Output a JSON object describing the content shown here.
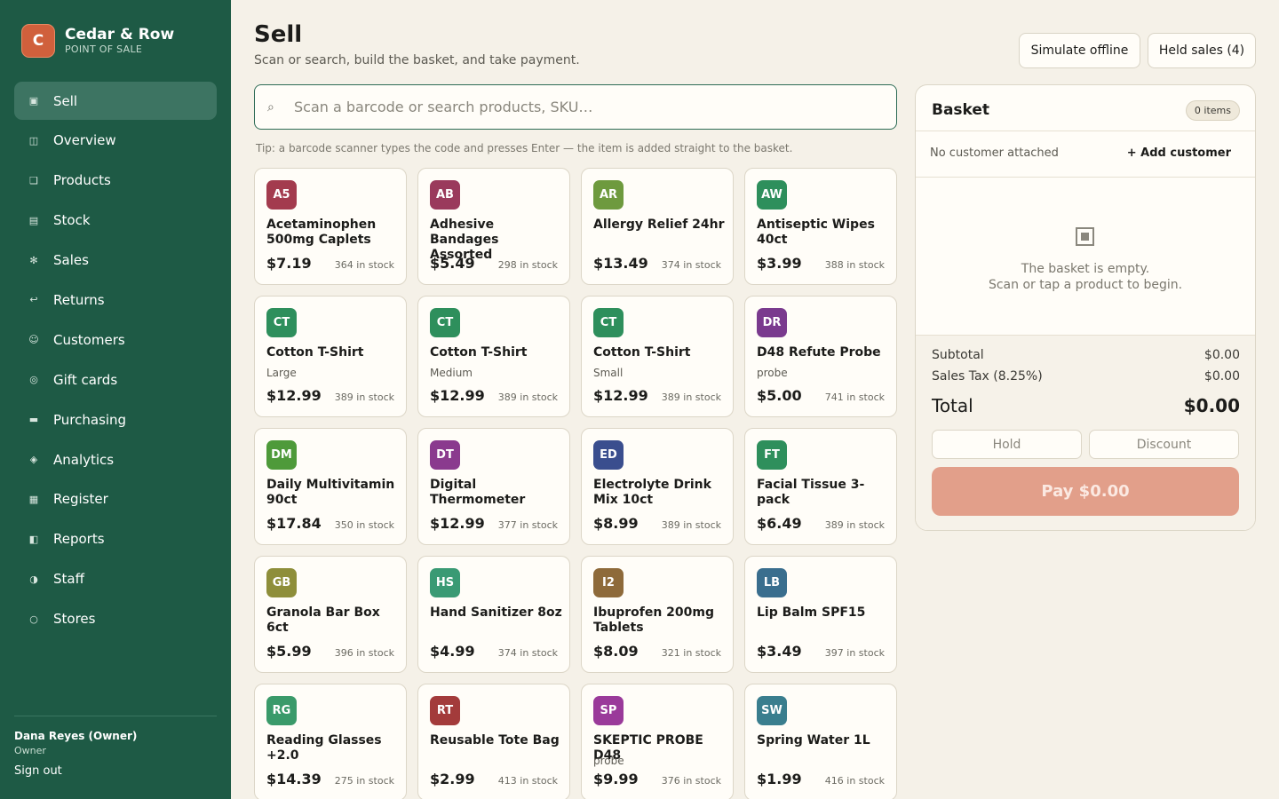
{
  "brand": {
    "logo_letter": "C",
    "name": "Cedar & Row",
    "subtitle": "POINT OF SALE"
  },
  "nav": [
    {
      "label": "Sell",
      "icon": "▣",
      "icon_name": "sell-icon",
      "active": true
    },
    {
      "label": "Overview",
      "icon": "◫",
      "icon_name": "overview-icon"
    },
    {
      "label": "Products",
      "icon": "❑",
      "icon_name": "products-icon"
    },
    {
      "label": "Stock",
      "icon": "▤",
      "icon_name": "stock-icon"
    },
    {
      "label": "Sales",
      "icon": "✻",
      "icon_name": "sales-icon"
    },
    {
      "label": "Returns",
      "icon": "↩",
      "icon_name": "returns-icon"
    },
    {
      "label": "Customers",
      "icon": "☺",
      "icon_name": "customers-icon"
    },
    {
      "label": "Gift cards",
      "icon": "◎",
      "icon_name": "gift-cards-icon"
    },
    {
      "label": "Purchasing",
      "icon": "▬",
      "icon_name": "purchasing-icon"
    },
    {
      "label": "Analytics",
      "icon": "◈",
      "icon_name": "analytics-icon"
    },
    {
      "label": "Register",
      "icon": "▦",
      "icon_name": "register-icon"
    },
    {
      "label": "Reports",
      "icon": "◧",
      "icon_name": "reports-icon"
    },
    {
      "label": "Staff",
      "icon": "◑",
      "icon_name": "staff-icon"
    },
    {
      "label": "Stores",
      "icon": "○",
      "icon_name": "stores-icon"
    }
  ],
  "user": {
    "name": "Dana Reyes (Owner)",
    "role": "Owner",
    "sign_out": "Sign out"
  },
  "header": {
    "title": "Sell",
    "subtitle": "Scan or search, build the basket, and take payment.",
    "offline_label": "Simulate offline",
    "held_label": "Held sales (4)"
  },
  "search": {
    "placeholder": "Scan a barcode or search products, SKU…",
    "icon": "⌕",
    "tip": "Tip: a barcode scanner types the code and presses Enter — the item is added straight to the basket."
  },
  "products": [
    {
      "code": "A5",
      "name": "Acetaminophen 500mg Caplets",
      "variant": "",
      "price": "$7.19",
      "stock": "364 in stock",
      "color": "#a33b4e"
    },
    {
      "code": "AB",
      "name": "Adhesive Bandages Assorted",
      "variant": "",
      "price": "$5.49",
      "stock": "298 in stock",
      "color": "#9a3a5c"
    },
    {
      "code": "AR",
      "name": "Allergy Relief 24hr",
      "variant": "",
      "price": "$13.49",
      "stock": "374 in stock",
      "color": "#6e9a3e"
    },
    {
      "code": "AW",
      "name": "Antiseptic Wipes 40ct",
      "variant": "",
      "price": "$3.99",
      "stock": "388 in stock",
      "color": "#2e8f5c"
    },
    {
      "code": "CT",
      "name": "Cotton T-Shirt",
      "variant": "Large",
      "price": "$12.99",
      "stock": "389 in stock",
      "color": "#2e8f5c"
    },
    {
      "code": "CT",
      "name": "Cotton T-Shirt",
      "variant": "Medium",
      "price": "$12.99",
      "stock": "389 in stock",
      "color": "#2e8f5c"
    },
    {
      "code": "CT",
      "name": "Cotton T-Shirt",
      "variant": "Small",
      "price": "$12.99",
      "stock": "389 in stock",
      "color": "#2e8f5c"
    },
    {
      "code": "DR",
      "name": "D48 Refute Probe",
      "variant": "probe",
      "price": "$5.00",
      "stock": "741 in stock",
      "color": "#7a3a8e"
    },
    {
      "code": "DM",
      "name": "Daily Multivitamin 90ct",
      "variant": "",
      "price": "$17.84",
      "stock": "350 in stock",
      "color": "#4e9a3a"
    },
    {
      "code": "DT",
      "name": "Digital Thermometer",
      "variant": "",
      "price": "$12.99",
      "stock": "377 in stock",
      "color": "#8a3a8e"
    },
    {
      "code": "ED",
      "name": "Electrolyte Drink Mix 10ct",
      "variant": "",
      "price": "$8.99",
      "stock": "389 in stock",
      "color": "#3a4e8e"
    },
    {
      "code": "FT",
      "name": "Facial Tissue 3-pack",
      "variant": "",
      "price": "$6.49",
      "stock": "389 in stock",
      "color": "#2e8f5c"
    },
    {
      "code": "GB",
      "name": "Granola Bar Box 6ct",
      "variant": "",
      "price": "$5.99",
      "stock": "396 in stock",
      "color": "#8e8e3a"
    },
    {
      "code": "HS",
      "name": "Hand Sanitizer 8oz",
      "variant": "",
      "price": "$4.99",
      "stock": "374 in stock",
      "color": "#3a9a74"
    },
    {
      "code": "I2",
      "name": "Ibuprofen 200mg Tablets",
      "variant": "",
      "price": "$8.09",
      "stock": "321 in stock",
      "color": "#8e6a3a"
    },
    {
      "code": "LB",
      "name": "Lip Balm SPF15",
      "variant": "",
      "price": "$3.49",
      "stock": "397 in stock",
      "color": "#3a6e8e"
    },
    {
      "code": "RG",
      "name": "Reading Glasses +2.0",
      "variant": "",
      "price": "$14.39",
      "stock": "275 in stock",
      "color": "#3a9a6a"
    },
    {
      "code": "RT",
      "name": "Reusable Tote Bag",
      "variant": "",
      "price": "$2.99",
      "stock": "413 in stock",
      "color": "#a33b3b"
    },
    {
      "code": "SP",
      "name": "SKEPTIC PROBE D48",
      "variant": "probe",
      "price": "$9.99",
      "stock": "376 in stock",
      "color": "#9a3a9a"
    },
    {
      "code": "SW",
      "name": "Spring Water 1L",
      "variant": "",
      "price": "$1.99",
      "stock": "416 in stock",
      "color": "#3a7e8e"
    }
  ],
  "basket": {
    "title": "Basket",
    "items_count": "0 items",
    "no_customer": "No customer attached",
    "add_customer": "+ Add customer",
    "empty_line1": "The basket is empty.",
    "empty_line2": "Scan or tap a product to begin.",
    "subtotal_label": "Subtotal",
    "subtotal_value": "$0.00",
    "tax_label": "Sales Tax (8.25%)",
    "tax_value": "$0.00",
    "total_label": "Total",
    "total_value": "$0.00",
    "hold_label": "Hold",
    "discount_label": "Discount",
    "pay_label": "Pay $0.00"
  }
}
